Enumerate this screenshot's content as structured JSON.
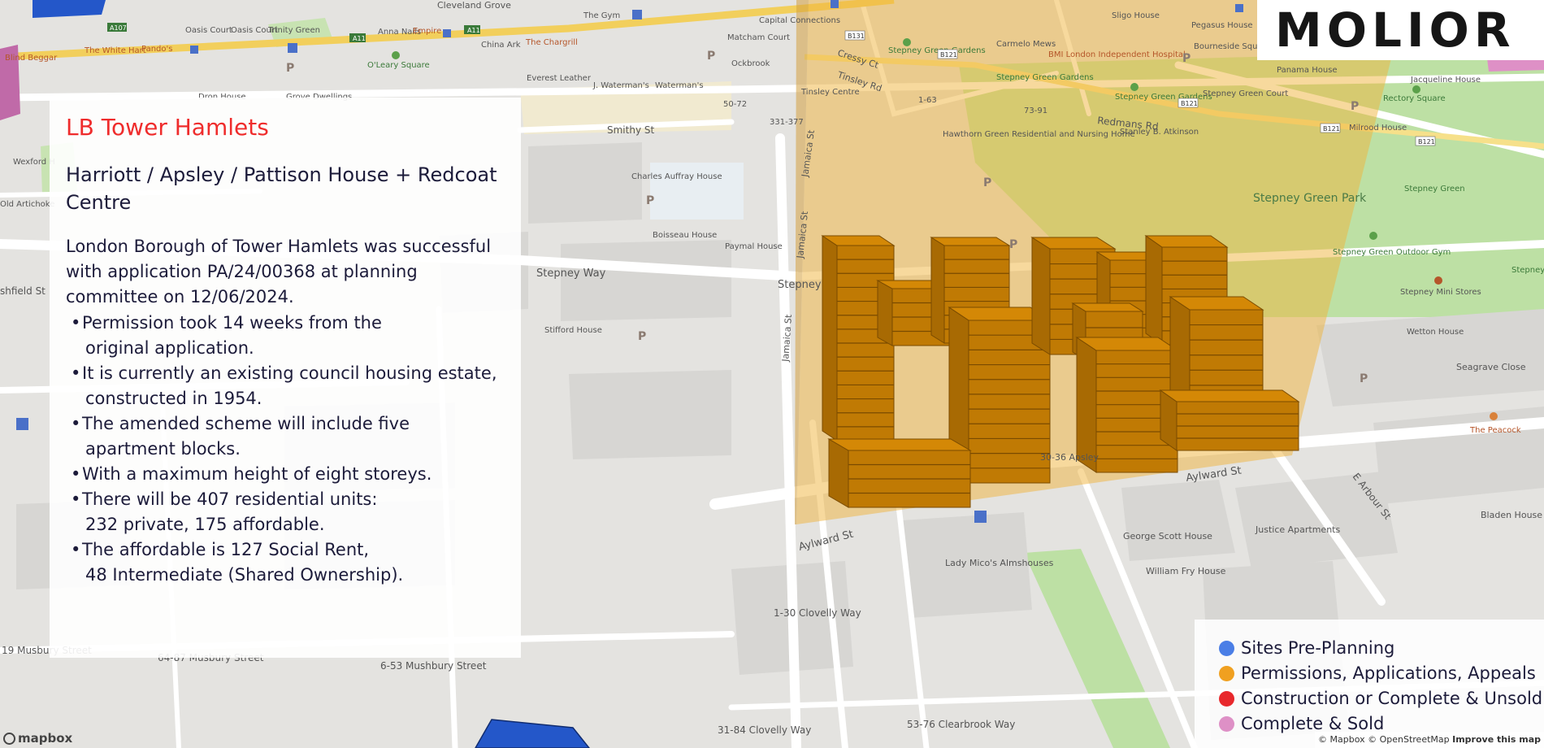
{
  "panel": {
    "region": "LB Tower Hamlets",
    "title": "Harriott / Apsley / Pattison House + Redcoat Centre",
    "description": "London Borough of Tower Hamlets was successful with application PA/24/00368 at planning committee on 12/06/2024.",
    "bullets": [
      [
        "Permission took 14 weeks from the",
        "original application."
      ],
      [
        "It is currently an existing council housing estate,",
        "constructed in 1954."
      ],
      [
        "The amended scheme will include five",
        "apartment blocks."
      ],
      [
        "With a maximum height of eight storeys."
      ],
      [
        "There will be 407 residential units:",
        "232 private, 175 affordable."
      ],
      [
        "The affordable is 127 Social Rent,",
        "48 Intermediate (Shared Ownership)."
      ]
    ]
  },
  "logo": {
    "text": "MOLIOR"
  },
  "legend": {
    "items": [
      {
        "label": "Sites Pre-Planning",
        "color": "#4a7ee6"
      },
      {
        "label": "Permissions, Applications, Appeals",
        "color": "#f0a020"
      },
      {
        "label": "Construction or Complete & Unsold",
        "color": "#e8282c"
      },
      {
        "label": "Complete & Sold",
        "color": "#de90c6"
      }
    ]
  },
  "attribution": {
    "mapbox": "© Mapbox",
    "osm": "© OpenStreetMap",
    "improve": "Improve this map"
  },
  "mapbox_logo": "mapbox",
  "map": {
    "colors": {
      "background": "#e4e3e0",
      "road": "#ffffff",
      "park": "#bde0a4",
      "overlay": "#f0b43c",
      "building_top": "#d48806",
      "building_side": "#c07a04",
      "building_outline": "#7a4b00",
      "site_blue": "#2457c9",
      "main_road": "#f2cf5c"
    },
    "street_labels": {
      "cleveland_grove": "Cleveland Grove",
      "the_gym": "The Gym",
      "capital_connections": "Capital Connections",
      "sligo_house": "Sligo House",
      "pegasus_house": "Pegasus House",
      "oasis_court_1": "Oasis Court",
      "oasis_court_2": "Oasis Court",
      "trinity_green": "Trinity Green",
      "the_white_hart": "The White Hart",
      "pando": "Pando's",
      "anna_nails": "Anna Nails",
      "empire": "Empire",
      "china_ark": "China Ark",
      "the_chargrill": "The Chargrill",
      "matcham_court": "Matcham Court",
      "ockbrook": "Ockbrook",
      "cressy_ct": "Cressy Ct",
      "tinsley_rd": "Tinsley Rd",
      "stepney_green_gardens_1": "Stepney Green Gardens",
      "stepney_green_gardens_2": "Stepney Green Gardens",
      "stepney_green_gardens_3": "Stepney Green Gardens",
      "carmelo_mews": "Carmelo Mews",
      "bmi_london": "BMI London Independent Hospital",
      "bourneside_square": "Bourneside Square",
      "panama_house": "Panama House",
      "jacqueline_house": "Jacqueline House",
      "rectory_square": "Rectory Square",
      "blind_beggar": "Blind Beggar",
      "oleary_square": "O'Leary Square",
      "everest_leather": "Everest Leather",
      "j_watermans": "J. Waterman's",
      "watermans": "Waterman's",
      "tinsley_centre": "Tinsley Centre",
      "stepney_green_court": "Stepney Green Court",
      "redmans_rd": "Redmans Rd",
      "stanley_b_atkinson": "Stanley B. Atkinson",
      "milrood_house": "Milrood House",
      "dron_house": "Dron House",
      "grove_dwellings": "Grove Dwellings",
      "smithy_st": "Smithy St",
      "range_5072": "50-72",
      "range_331377": "331-377",
      "range_163": "1-63",
      "range_7391": "73-91",
      "hawthorn_green": "Hawthorn Green Residential and Nursing Home",
      "wexford_h": "Wexford H",
      "old_artichoke": "Old Artichoke",
      "charles_auffray": "Charles Auffray House",
      "jamaica_st_1": "Jamaica St",
      "jamaica_st_2": "Jamaica St",
      "jamaica_st_3": "Jamaica St",
      "stepney_green_park": "Stepney Green Park",
      "stepney_green": "Stepney Green",
      "stepney_green_outdoor_gym": "Stepney Green Outdoor Gym",
      "stepney_green_junior": "Stepney Green Junior Playground",
      "stepney_mini_stores": "Stepney Mini Stores",
      "boisseau_house": "Boisseau House",
      "paymal_house": "Paymal House",
      "stepney_way_1": "Stepney Way",
      "stepney_way_2": "Stepney",
      "ashfield_st": "shfield St",
      "stifford_house": "Stifford House",
      "wetton_house": "Wetton House",
      "seagrave_close": "Seagrave Close",
      "the_peacock": "The Peacock",
      "aylward_st_1": "Aylward St",
      "aylward_st_2": "Aylward St",
      "range_3036_apsley": "30-36 Apsley",
      "e_arbour_st": "E Arbour St",
      "george_scott_house": "George Scott House",
      "justice_apartments": "Justice Apartments",
      "bladen_house": "Bladen House",
      "william_fry_house": "William Fry House",
      "lady_micos": "Lady Mico's Almshouses",
      "clovelly_130": "1-30 Clovelly Way",
      "clovelly_3184": "31-84 Clovelly Way",
      "clearbrook": "53-76 Clearbrook Way",
      "mushbury_653": "6-53 Mushbury Street",
      "mushbury_19": "19 Musbury Street",
      "mushbury_6487": "64-87 Musbury Street",
      "road_a107": "A107",
      "road_a11_1": "A11",
      "road_a11_2": "A11",
      "road_b131": "B131",
      "road_b121_1": "B121",
      "road_b121_2": "B121",
      "road_b121_3": "B121",
      "road_b121_4": "B121",
      "parking": "P"
    }
  }
}
